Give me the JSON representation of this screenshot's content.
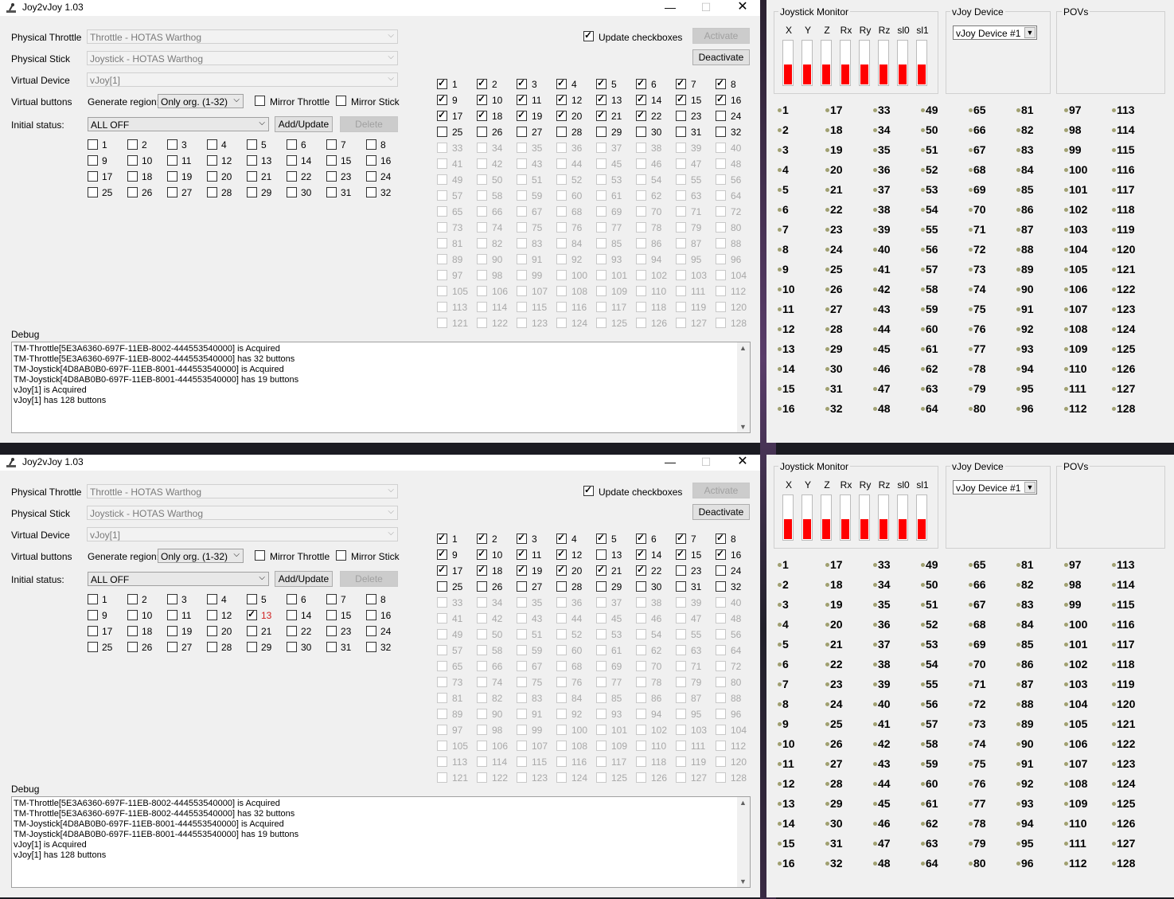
{
  "windows": [
    {
      "title": "Joy2vJoy 1.03",
      "controls": {
        "minimize": "—",
        "maximize": "☐",
        "close": "✕"
      },
      "labels": {
        "physical_throttle": "Physical Throttle",
        "physical_stick": "Physical Stick",
        "virtual_device": "Virtual Device",
        "virtual_buttons": "Virtual buttons",
        "initial_status": "Initial status:",
        "debug": "Debug",
        "generate_region": "Generate region:"
      },
      "throttle_value": "Throttle - HOTAS Warthog",
      "stick_value": "Joystick - HOTAS Warthog",
      "vdevice_value": "vJoy[1]",
      "region_value": "Only org. (1-32)",
      "mirror_throttle": "Mirror Throttle",
      "mirror_stick": "Mirror Stick",
      "status_value": "ALL OFF",
      "add_update": "Add/Update",
      "delete": "Delete",
      "update_checkboxes": "Update checkboxes",
      "activate": "Activate",
      "deactivate": "Deactivate",
      "initial_checked": [],
      "right_checked": [
        1,
        2,
        3,
        4,
        5,
        6,
        7,
        8,
        9,
        10,
        11,
        12,
        13,
        14,
        15,
        16,
        17,
        18,
        19,
        20,
        21,
        22
      ],
      "debug_lines": [
        "TM-Throttle[5E3A6360-697F-11EB-8002-444553540000] is Acquired",
        "TM-Throttle[5E3A6360-697F-11EB-8002-444553540000] has 32 buttons",
        "TM-Joystick[4D8AB0B0-697F-11EB-8001-444553540000] is Acquired",
        "TM-Joystick[4D8AB0B0-697F-11EB-8001-444553540000] has 19 buttons",
        "vJoy[1] is Acquired",
        "vJoy[1] has 128 buttons"
      ]
    },
    {
      "title": "Joy2vJoy 1.03",
      "controls": {
        "minimize": "—",
        "maximize": "☐",
        "close": "✕"
      },
      "labels": {
        "physical_throttle": "Physical Throttle",
        "physical_stick": "Physical Stick",
        "virtual_device": "Virtual Device",
        "virtual_buttons": "Virtual buttons",
        "initial_status": "Initial status:",
        "debug": "Debug",
        "generate_region": "Generate region:"
      },
      "throttle_value": "Throttle - HOTAS Warthog",
      "stick_value": "Joystick - HOTAS Warthog",
      "vdevice_value": "vJoy[1]",
      "region_value": "Only org. (1-32)",
      "mirror_throttle": "Mirror Throttle",
      "mirror_stick": "Mirror Stick",
      "status_value": "ALL OFF",
      "add_update": "Add/Update",
      "delete": "Delete",
      "update_checkboxes": "Update checkboxes",
      "activate": "Activate",
      "deactivate": "Deactivate",
      "initial_checked": [
        13
      ],
      "right_checked": [
        1,
        2,
        3,
        4,
        5,
        6,
        7,
        8,
        9,
        10,
        11,
        12,
        14,
        15,
        16,
        17,
        18,
        19,
        20,
        21,
        22
      ],
      "debug_lines": [
        "TM-Throttle[5E3A6360-697F-11EB-8002-444553540000] is Acquired",
        "TM-Throttle[5E3A6360-697F-11EB-8002-444553540000] has 32 buttons",
        "TM-Joystick[4D8AB0B0-697F-11EB-8001-444553540000] is Acquired",
        "TM-Joystick[4D8AB0B0-697F-11EB-8001-444553540000] has 19 buttons",
        "vJoy[1] is Acquired",
        "vJoy[1] has 128 buttons"
      ]
    }
  ],
  "monitor": {
    "joystick_monitor_title": "Joystick Monitor",
    "vjoy_device_title": "vJoy Device",
    "povs_title": "POVs",
    "device_value": "vJoy Device #1",
    "axes": [
      {
        "name": "X",
        "level_percent": 45
      },
      {
        "name": "Y",
        "level_percent": 45
      },
      {
        "name": "Z",
        "level_percent": 45
      },
      {
        "name": "Rx",
        "level_percent": 45
      },
      {
        "name": "Ry",
        "level_percent": 45
      },
      {
        "name": "Rz",
        "level_percent": 45
      },
      {
        "name": "sl0",
        "level_percent": 45
      },
      {
        "name": "sl1",
        "level_percent": 45
      }
    ],
    "button_count": 128,
    "led_color": "#a0a070",
    "axis_color": "#ff0000"
  }
}
